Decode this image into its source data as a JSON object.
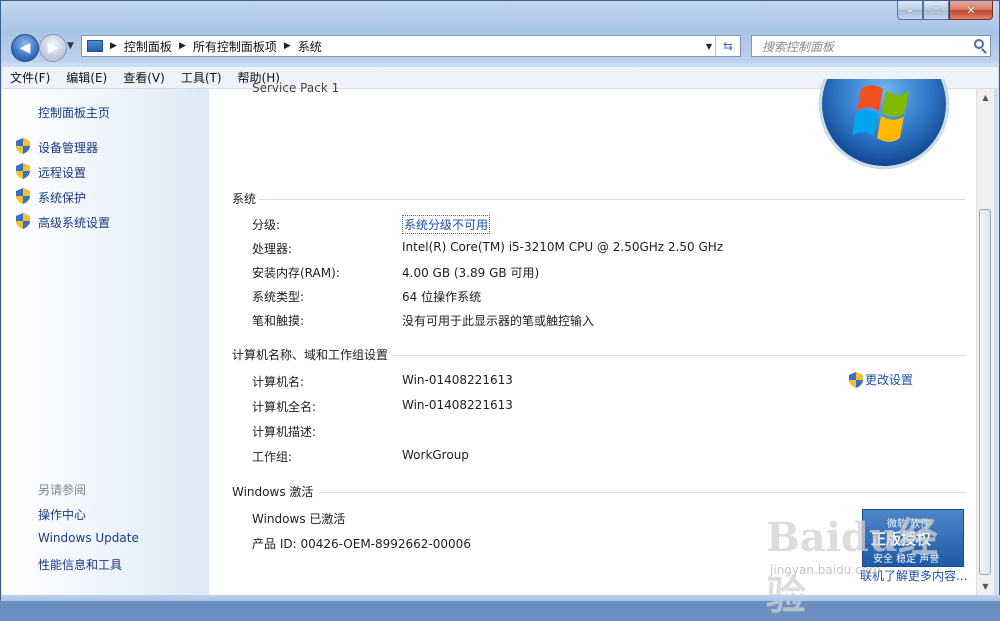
{
  "window": {
    "caption_min": "–",
    "caption_max": "□",
    "caption_close": "✕"
  },
  "address": {
    "crumbs": [
      "控制面板",
      "所有控制面板项",
      "系统"
    ],
    "search_placeholder": "搜索控制面板"
  },
  "menu": [
    "文件(F)",
    "编辑(E)",
    "查看(V)",
    "工具(T)",
    "帮助(H)"
  ],
  "sidebar": {
    "home": "控制面板主页",
    "links": [
      "设备管理器",
      "远程设置",
      "系统保护",
      "高级系统设置"
    ],
    "see_also_title": "另请参阅",
    "see_also": [
      "操作中心",
      "Windows Update",
      "性能信息和工具"
    ]
  },
  "content": {
    "clipped_top": "Service Pack 1",
    "system": {
      "title": "系统",
      "rows": [
        {
          "label": "分级:",
          "value": "系统分级不可用"
        },
        {
          "label": "处理器:",
          "value": "Intel(R) Core(TM) i5-3210M CPU @ 2.50GHz   2.50 GHz"
        },
        {
          "label": "安装内存(RAM):",
          "value": "4.00 GB (3.89 GB 可用)"
        },
        {
          "label": "系统类型:",
          "value": "64 位操作系统"
        },
        {
          "label": "笔和触摸:",
          "value": "没有可用于此显示器的笔或触控输入"
        }
      ]
    },
    "computer": {
      "title": "计算机名称、域和工作组设置",
      "change_settings": "更改设置",
      "rows": [
        {
          "label": "计算机名:",
          "value": "Win-01408221613"
        },
        {
          "label": "计算机全名:",
          "value": "Win-01408221613"
        },
        {
          "label": "计算机描述:",
          "value": ""
        },
        {
          "label": "工作组:",
          "value": "WorkGroup"
        }
      ]
    },
    "activation": {
      "title": "Windows 激活",
      "status": "Windows 已激活",
      "product_id": "产品 ID: 00426-OEM-8992662-00006",
      "badge_top": "微软 软件",
      "badge_main": "正版授权",
      "badge_bottom": "安全 稳定 声誉",
      "learn_more": "联机了解更多内容..."
    }
  },
  "watermark": {
    "main": "Baidu经验",
    "sub": "jingyan.baidu.com"
  },
  "colors": {
    "link": "#1a52a8",
    "chrome": "#a9c4e6"
  }
}
